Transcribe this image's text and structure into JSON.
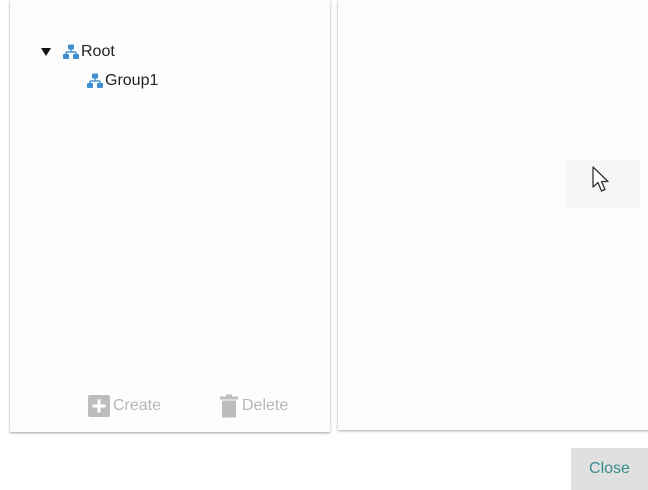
{
  "tree": {
    "root": {
      "label": "Root",
      "expanded": true,
      "icon": "group-icon"
    },
    "children": [
      {
        "label": "Group1",
        "icon": "group-icon"
      }
    ]
  },
  "actions": {
    "create_label": "Create",
    "delete_label": "Delete",
    "create_icon": "plus-icon",
    "delete_icon": "trash-icon",
    "disabled": true
  },
  "footer": {
    "close_label": "Close"
  },
  "colors": {
    "group_icon": "#3f8fd0",
    "disabled_text": "#b7b7b7",
    "close_text": "#3a8c8c",
    "close_bg": "#e0e0e0"
  }
}
